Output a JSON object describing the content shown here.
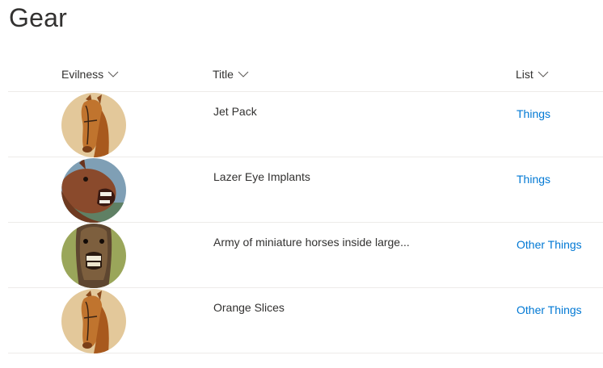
{
  "page": {
    "title": "Gear"
  },
  "columns": {
    "evilness": "Evilness",
    "title": "Title",
    "list": "List"
  },
  "rows": [
    {
      "title": "Jet Pack",
      "list": "Things",
      "icon": "horse-portrait-image"
    },
    {
      "title": "Lazer Eye Implants",
      "list": "Things",
      "icon": "laughing-horse-image"
    },
    {
      "title": "Army of miniature horses inside large...",
      "list": "Other Things",
      "icon": "grinning-horse-image"
    },
    {
      "title": "Orange Slices",
      "list": "Other Things",
      "icon": "horse-portrait-image"
    }
  ],
  "colors": {
    "link": "#0078d4",
    "text": "#323130",
    "divider": "#edebe9"
  }
}
